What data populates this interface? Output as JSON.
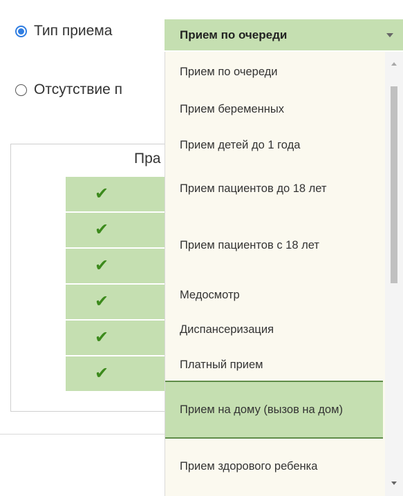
{
  "form": {
    "reception_type_label": "Тип приема",
    "absence_label": "Отсутствие п",
    "legend_partial": "Пра"
  },
  "select": {
    "value": "Прием по очереди",
    "icon": "chevron-down-icon"
  },
  "dropdown": {
    "options": [
      {
        "label": "Прием по очереди"
      },
      {
        "label": "Прием беременных"
      },
      {
        "label": "Прием детей до 1 года"
      },
      {
        "label": "Прием пациентов до 18 лет"
      },
      {
        "label": "Прием пациентов с 18 лет"
      },
      {
        "label": "Медосмотр"
      },
      {
        "label": "Диспансеризация"
      },
      {
        "label": "Платный прием"
      },
      {
        "label": "Прием на дому (вызов на дом)"
      },
      {
        "label": "Прием здорового ребенка"
      }
    ],
    "highlighted": "Прием на дому (вызов на дом)"
  },
  "grid": {
    "check_icon": "checkmark-icon",
    "check_symbol": "✔",
    "rows": [
      {
        "checked": true
      },
      {
        "checked": true
      },
      {
        "checked": true
      },
      {
        "checked": true
      },
      {
        "checked": true
      },
      {
        "checked": true
      }
    ]
  },
  "colors": {
    "accent_green": "#c5dfb1",
    "radio_blue": "#2f7de1",
    "dropdown_bg": "#fbf9ef",
    "check_green": "#3c8a1c"
  }
}
